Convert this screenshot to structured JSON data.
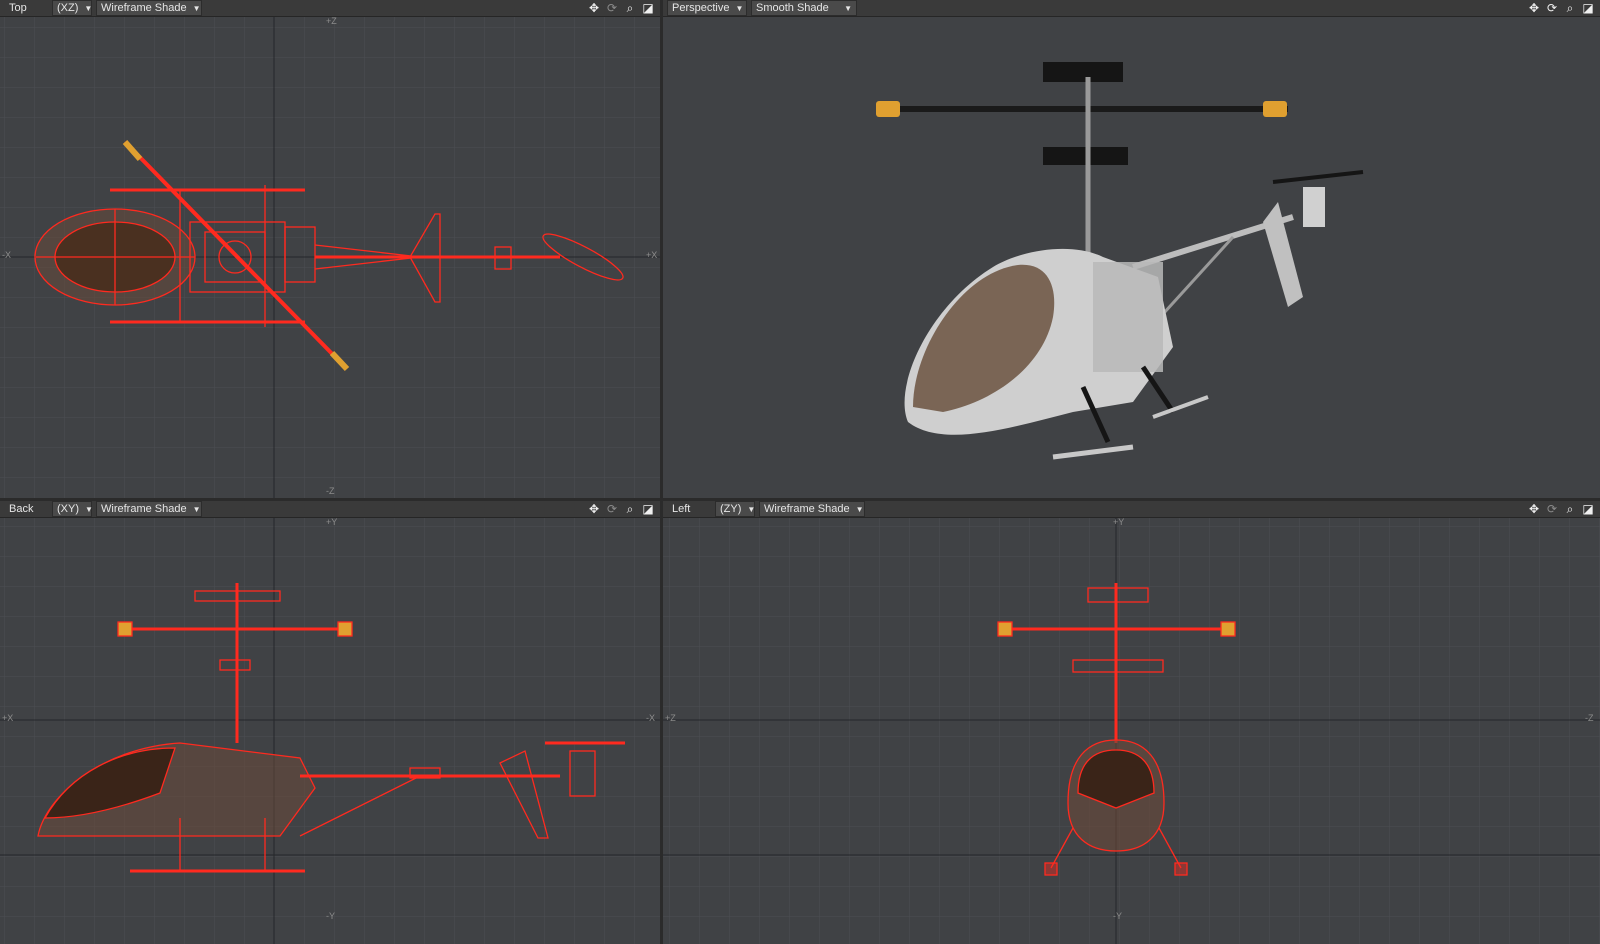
{
  "viewports": {
    "top": {
      "view": "Top",
      "plane": "(XZ)",
      "shade": "Wireframe Shade",
      "axis_top": "+Z",
      "axis_bottom": "-Z",
      "axis_left": "-X",
      "axis_right": "+X"
    },
    "persp": {
      "view": "Perspective",
      "shade": "Smooth Shade"
    },
    "back": {
      "view": "Back",
      "plane": "(XY)",
      "shade": "Wireframe Shade",
      "axis_top": "+Y",
      "axis_bottom": "-Y",
      "axis_left": "+X",
      "axis_right": "-X"
    },
    "left": {
      "view": "Left",
      "plane": "(ZY)",
      "shade": "Wireframe Shade",
      "axis_top": "+Y",
      "axis_bottom": "-Y",
      "axis_left": "+Z",
      "axis_right": "-Z"
    }
  },
  "toolbar_icons": [
    "move-icon",
    "rotate-icon",
    "zoom-icon",
    "maximize-icon"
  ],
  "colors": {
    "viewport_bg": "#404245",
    "grid_minor": "#4b4d50",
    "wire": "#ff2a1f",
    "accent_blade_tip": "#e0a030"
  }
}
